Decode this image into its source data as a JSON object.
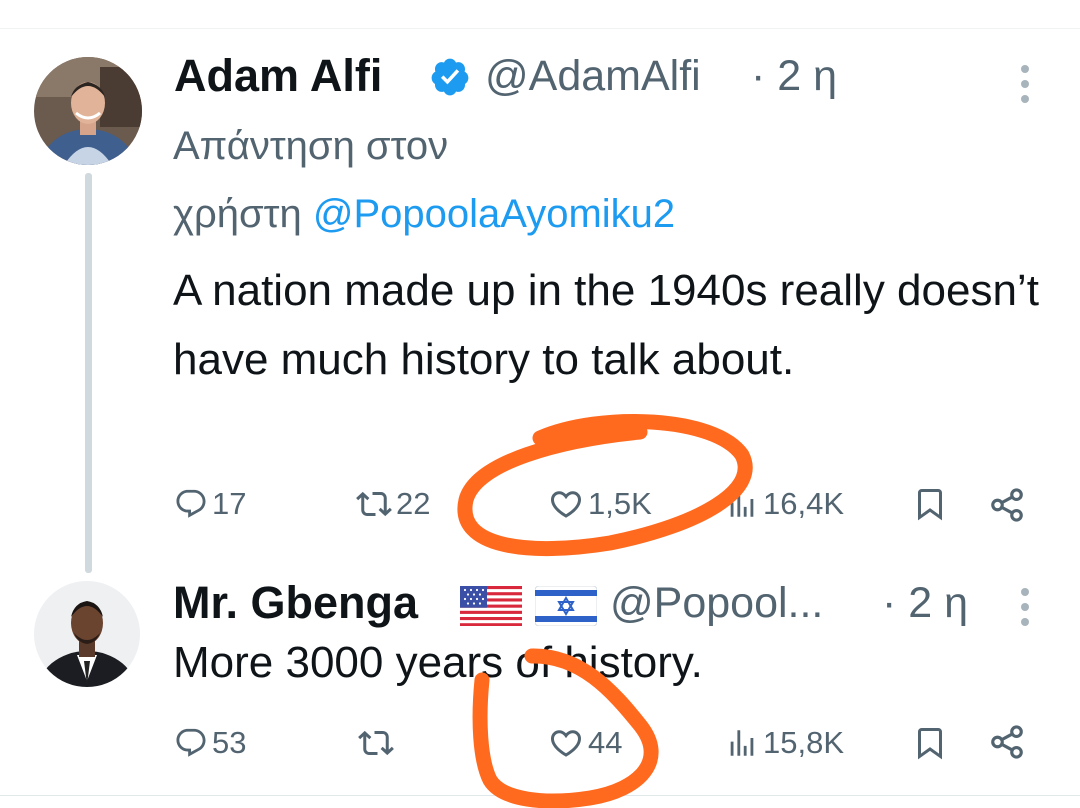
{
  "colors": {
    "text": "#0f1419",
    "secondary": "#536471",
    "mention": "#1d9bf0",
    "verified": "#1d9bf0",
    "annotation": "#ff6a1f"
  },
  "tweets": [
    {
      "author_name": "Adam Alfi",
      "verified": true,
      "handle": "@AdamAlfi",
      "time": "· 2 η",
      "reply_prefix_line1": "Απάντηση στον",
      "reply_prefix_line2": "χρήστη",
      "reply_mention": "@PopoolaAyomiku2",
      "text": "A nation made up in the 1940s really doesn’t have much history to talk about.",
      "actions": {
        "replies": "17",
        "retweets": "22",
        "likes": "1,5K",
        "views": "16,4K"
      }
    },
    {
      "author_name": "Mr. Gbenga",
      "flags": [
        "us-flag",
        "israel-flag"
      ],
      "handle": "@Popool...",
      "time": "· 2 η",
      "text": "More 3000 years of history.",
      "actions": {
        "replies": "53",
        "retweets": "",
        "likes": "44",
        "views": "15,8K"
      }
    }
  ]
}
